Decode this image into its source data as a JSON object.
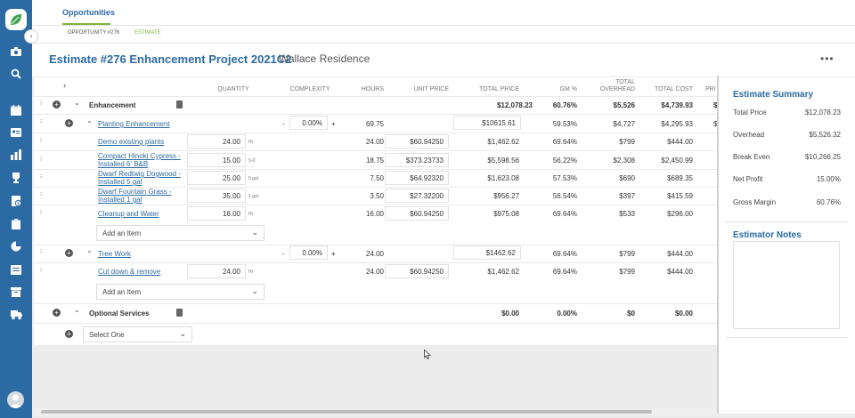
{
  "nav": {
    "opportunities": "Opportunities"
  },
  "breadcrumb": {
    "opportunity": "OPPORTUNITY #276",
    "estimate": "ESTIMATE"
  },
  "header": {
    "title": "Estimate #276 Enhancement Project 2021C2",
    "client": "Wallace Residence",
    "more": "•••"
  },
  "table": {
    "columns": {
      "quantity": "QUANTITY",
      "complexity": "COMPLEXITY",
      "hours": "HOURS",
      "unit_price": "UNIT PRICE",
      "total_price": "TOTAL PRICE",
      "gm": "GM %",
      "total_overhead_1": "TOTAL",
      "total_overhead_2": "OVERHEAD",
      "total_cost": "TOTAL COST",
      "price_cut": "PRI"
    },
    "sections": [
      {
        "name": "Enhancement",
        "total_price": "$12,078.23",
        "gm": "60.76%",
        "overhead": "$5,526",
        "total_cost": "$4,739.93",
        "cut": "$"
      },
      {
        "name": "Optional Services",
        "total_price": "$0.00",
        "gm": "0.00%",
        "overhead": "$0",
        "total_cost": "$0.00"
      }
    ],
    "groups": [
      {
        "name": "Planting Enhancement",
        "minus": "-",
        "complexity": "0.00%",
        "plus": "+",
        "hours": "69.75",
        "total_price": "$10615.61",
        "gm": "59.53%",
        "overhead": "$4,727",
        "total_cost": "$4,295.93",
        "cut": "$"
      },
      {
        "name": "Tree Work",
        "minus": "-",
        "complexity": "0.00%",
        "plus": "+",
        "hours": "24.00",
        "total_price": "$1462.62",
        "gm": "69.64%",
        "overhead": "$799",
        "total_cost": "$444.00"
      }
    ],
    "items": [
      {
        "name": "Demo existing plants",
        "qty": "24.00",
        "unit": "Hr",
        "hours": "24.00",
        "unit_price": "$60.94250",
        "total_price": "$1,462.62",
        "gm": "69.64%",
        "overhead": "$799",
        "total_cost": "$444.00"
      },
      {
        "name1": "Compact Hinoki Cypress -",
        "name2": "Installed 6' B&B",
        "qty": "15.00",
        "unit": "5-6'",
        "hours": "18.75",
        "unit_price": "$373.23733",
        "total_price": "$5,598.56",
        "gm": "56.22%",
        "overhead": "$2,308",
        "total_cost": "$2,450.99"
      },
      {
        "name1": "Dwarf Redtwig Dogwood -",
        "name2": "Installed 5 gal",
        "qty": "25.00",
        "unit": "5 gal",
        "hours": "7.50",
        "unit_price": "$64.92320",
        "total_price": "$1,623.08",
        "gm": "57.53%",
        "overhead": "$690",
        "total_cost": "$689.35"
      },
      {
        "name1": "Dwarf Fountain Grass -",
        "name2": "Installed 1 gal",
        "qty": "35.00",
        "unit": "1 gal",
        "hours": "3.50",
        "unit_price": "$27.32200",
        "total_price": "$956.27",
        "gm": "56.54%",
        "overhead": "$397",
        "total_cost": "$415.59"
      },
      {
        "name": "Cleanup and Water",
        "qty": "16.00",
        "unit": "Hr",
        "hours": "16.00",
        "unit_price": "$60.94250",
        "total_price": "$975.08",
        "gm": "69.64%",
        "overhead": "$533",
        "total_cost": "$296.00"
      },
      {
        "name": "Cut down & remove",
        "qty": "24.00",
        "unit": "Hr",
        "hours": "24.00",
        "unit_price": "$60.94250",
        "total_price": "$1,462.62",
        "gm": "69.64%",
        "overhead": "$799",
        "total_cost": "$444.00"
      }
    ],
    "add_item": "Add an Item",
    "select_one": "Select One"
  },
  "summary": {
    "title": "Estimate Summary",
    "rows": [
      {
        "label": "Total Price",
        "value": "$12,078.23"
      },
      {
        "label": "Overhead",
        "value": "$5,526.32"
      },
      {
        "label": "Break Even",
        "value": "$10,266.25"
      },
      {
        "label": "Net Profit",
        "value": "15.00%"
      },
      {
        "label": "Gross Margin",
        "value": "60.76%"
      }
    ],
    "notes_title": "Estimator Notes"
  },
  "icons": [
    "app-logo-icon",
    "camera-icon",
    "search-icon",
    "calendar-icon",
    "contact-card-icon",
    "bar-chart-icon",
    "trophy-icon",
    "dollar-file-icon",
    "clipboard-icon",
    "pie-chart-icon",
    "report-icon",
    "archive-icon",
    "truck-icon",
    "avatar-icon",
    "chevron-right-icon",
    "chevron-down-icon",
    "plus-circle-icon",
    "document-icon",
    "drag-handle-icon",
    "more-icon",
    "mouse-cursor-icon"
  ],
  "colors": {
    "brand": "#2c6aa3",
    "accent": "#7db33c",
    "sidebar": "#2c6aa3"
  }
}
